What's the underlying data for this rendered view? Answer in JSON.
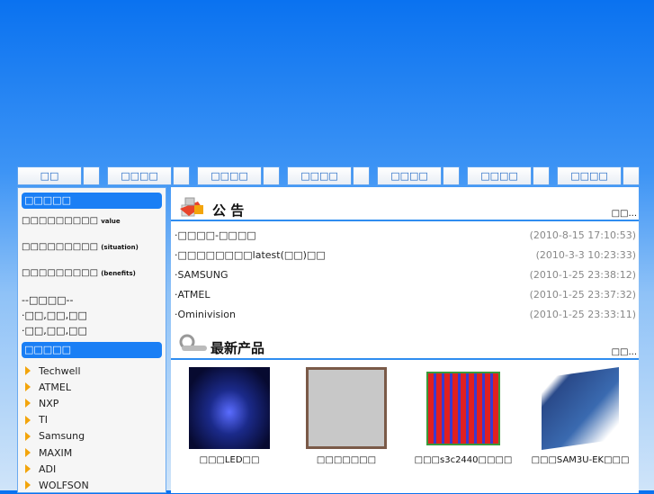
{
  "nav": [
    {
      "label": "□□"
    },
    {
      "label": "□□□□"
    },
    {
      "label": "□□□□"
    },
    {
      "label": "□□□□"
    },
    {
      "label": "□□□□"
    },
    {
      "label": "□□□□"
    },
    {
      "label": "□□□□"
    }
  ],
  "sidebar": {
    "header1": "□□□□□",
    "texts": [
      {
        "cn": "□□□□□□□□□",
        "en": "value"
      },
      {
        "cn": "□□□□□□□□□",
        "en": "(situation)"
      },
      {
        "cn": "□□□□□□□□□",
        "en": "(benefits)"
      }
    ],
    "links_title": "--□□□□--",
    "links": [
      "·□□,□□,□□",
      "·□□,□□,□□"
    ],
    "header2": "□□□□□",
    "brands": [
      "Techwell",
      "ATMEL",
      "NXP",
      "TI",
      "Samsung",
      "MAXIM",
      "ADI",
      "WOLFSON"
    ]
  },
  "notice": {
    "title": "公 告",
    "more": "□□...",
    "items": [
      {
        "text": "·□□□□-□□□□",
        "date": "(2010-8-15 17:10:53)"
      },
      {
        "text": "·□□□□□□□□latest(□□)□□",
        "date": "(2010-3-3 10:23:33)"
      },
      {
        "text": "·SAMSUNG",
        "date": "(2010-1-25 23:38:12)"
      },
      {
        "text": "·ATMEL",
        "date": "(2010-1-25 23:37:32)"
      },
      {
        "text": "·Ominivision",
        "date": "(2010-1-25 23:33:11)"
      }
    ]
  },
  "products": {
    "title": "最新产品",
    "more": "□□...",
    "items": [
      {
        "caption": "□□□LED□□"
      },
      {
        "caption": "□□□□□□□"
      },
      {
        "caption": "□□□s3c2440□□□□"
      },
      {
        "caption": "□□□SAM3U-EK□□□"
      }
    ]
  }
}
